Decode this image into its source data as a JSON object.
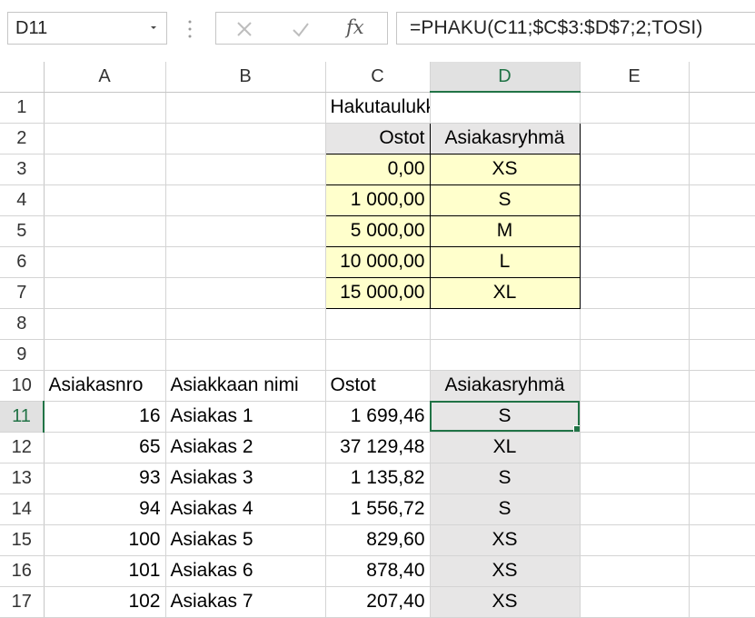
{
  "name_box": {
    "value": "D11"
  },
  "formula_bar": {
    "cancel_icon": "close-icon",
    "enter_icon": "checkmark-icon",
    "function_label": "fx",
    "formula": "=PHAKU(C11;$C$3:$D$7;2;TOSI)"
  },
  "columns": [
    "A",
    "B",
    "C",
    "D",
    "E"
  ],
  "active_cell": {
    "column": "D",
    "row": "11"
  },
  "rows": [
    {
      "n": "1",
      "A": "",
      "B": "",
      "C": "Hakutaulukko",
      "D": ""
    },
    {
      "n": "2",
      "A": "",
      "B": "",
      "C": "Ostot",
      "D": "Asiakasryhmä"
    },
    {
      "n": "3",
      "A": "",
      "B": "",
      "C": "0,00",
      "D": "XS"
    },
    {
      "n": "4",
      "A": "",
      "B": "",
      "C": "1 000,00",
      "D": "S"
    },
    {
      "n": "5",
      "A": "",
      "B": "",
      "C": "5 000,00",
      "D": "M"
    },
    {
      "n": "6",
      "A": "",
      "B": "",
      "C": "10 000,00",
      "D": "L"
    },
    {
      "n": "7",
      "A": "",
      "B": "",
      "C": "15 000,00",
      "D": "XL"
    },
    {
      "n": "8",
      "A": "",
      "B": "",
      "C": "",
      "D": ""
    },
    {
      "n": "9",
      "A": "",
      "B": "",
      "C": "",
      "D": ""
    },
    {
      "n": "10",
      "A": "Asiakasnro",
      "B": "Asiakkaan nimi",
      "C": "Ostot",
      "D": "Asiakasryhmä"
    },
    {
      "n": "11",
      "A": "16",
      "B": "Asiakas 1",
      "C": "1 699,46",
      "D": "S"
    },
    {
      "n": "12",
      "A": "65",
      "B": "Asiakas 2",
      "C": "37 129,48",
      "D": "XL"
    },
    {
      "n": "13",
      "A": "93",
      "B": "Asiakas 3",
      "C": "1 135,82",
      "D": "S"
    },
    {
      "n": "14",
      "A": "94",
      "B": "Asiakas 4",
      "C": "1 556,72",
      "D": "S"
    },
    {
      "n": "15",
      "A": "100",
      "B": "Asiakas 5",
      "C": "829,60",
      "D": "XS"
    },
    {
      "n": "16",
      "A": "101",
      "B": "Asiakas 6",
      "C": "878,40",
      "D": "XS"
    },
    {
      "n": "17",
      "A": "102",
      "B": "Asiakas 7",
      "C": "207,40",
      "D": "XS"
    }
  ],
  "colors": {
    "accent_green": "#217346",
    "lookup_fill": "#ffffcc",
    "result_fill": "#e7e6e6"
  }
}
